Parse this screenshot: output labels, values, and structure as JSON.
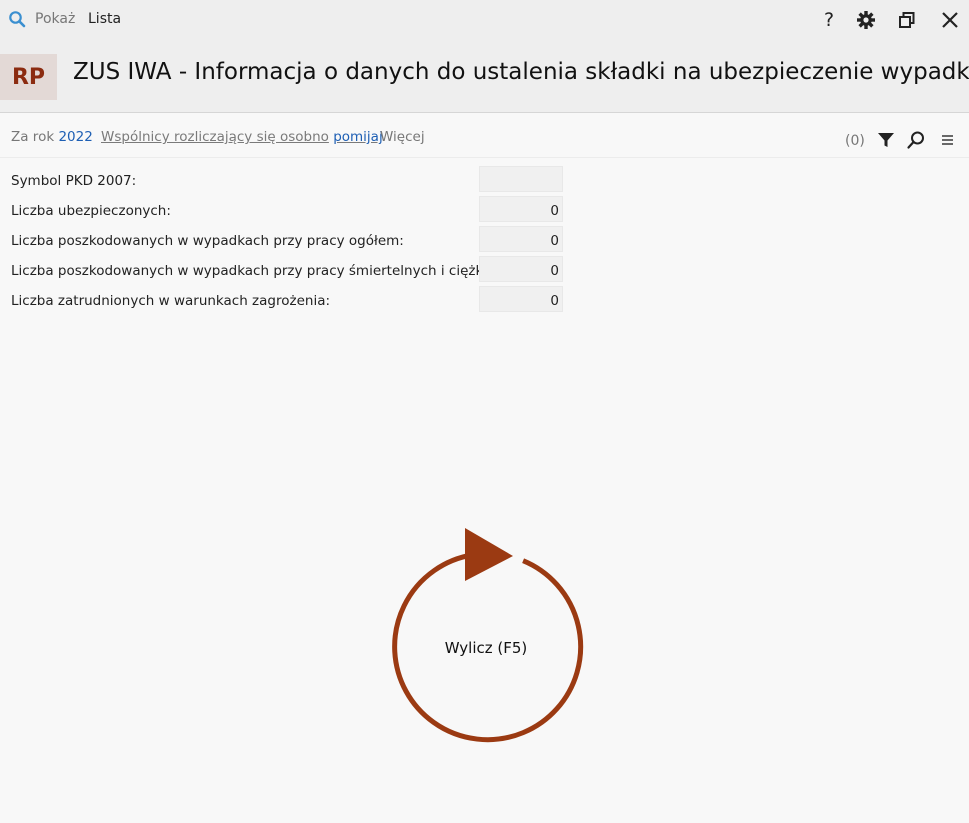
{
  "topbar": {
    "show_label": "Pokaż",
    "list_label": "Lista",
    "help_label": "?"
  },
  "header": {
    "badge": "RP",
    "title": "ZUS IWA - Informacja o danych do ustalenia składki na ubezpieczenie wypadkowe"
  },
  "filters": {
    "year_label": "Za rok",
    "year_value": "2022",
    "partners_label": "Wspólnicy rozliczający się osobno",
    "partners_value": "pomijaj",
    "more_label": "Więcej",
    "count": "(0)"
  },
  "form": {
    "rows": [
      {
        "label": "Symbol PKD 2007:",
        "value": ""
      },
      {
        "label": "Liczba ubezpieczonych:",
        "value": "0"
      },
      {
        "label": "Liczba poszkodowanych w wypadkach przy pracy ogółem:",
        "value": "0"
      },
      {
        "label": "Liczba poszkodowanych w wypadkach przy pracy śmiertelnych i ciężkich:",
        "value": "0"
      },
      {
        "label": "Liczba zatrudnionych w warunkach zagrożenia:",
        "value": "0"
      }
    ]
  },
  "calculate": {
    "label": "Wylicz (F5)"
  },
  "colors": {
    "accent": "#9b3a12",
    "link": "#1e5fb4",
    "badge_bg": "#e3d9d6"
  }
}
